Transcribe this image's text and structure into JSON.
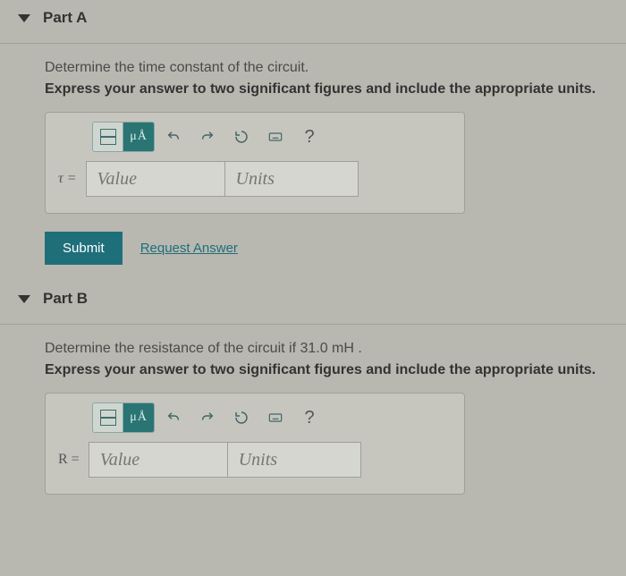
{
  "partA": {
    "title": "Part A",
    "prompt": "Determine the time constant of the circuit.",
    "instruction": "Express your answer to two significant figures and include the appropriate units.",
    "toolbar": {
      "mu_label": "μÅ",
      "help": "?"
    },
    "variable": "τ =",
    "value_placeholder": "Value",
    "units_placeholder": "Units",
    "submit": "Submit",
    "request": "Request Answer"
  },
  "partB": {
    "title": "Part B",
    "prompt": "Determine the resistance of the circuit if 31.0  mH .",
    "instruction": "Express your answer to two significant figures and include the appropriate units.",
    "toolbar": {
      "mu_label": "μÅ",
      "help": "?"
    },
    "variable": "R =",
    "value_placeholder": "Value",
    "units_placeholder": "Units"
  }
}
